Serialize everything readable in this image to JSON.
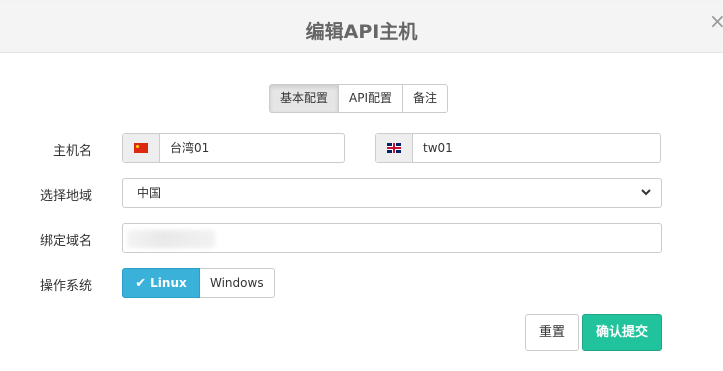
{
  "dialog": {
    "title": "编辑API主机",
    "close_glyph": "×"
  },
  "tabs": [
    {
      "label": "基本配置",
      "active": true
    },
    {
      "label": "API配置",
      "active": false
    },
    {
      "label": "备注",
      "active": false
    }
  ],
  "form": {
    "hostname_label": "主机名",
    "hostname_cn": {
      "flag_icon": "china-flag-icon",
      "value": "台湾01"
    },
    "hostname_en": {
      "flag_icon": "uk-flag-icon",
      "value": "tw01"
    },
    "region_label": "选择地域",
    "region_selected": "中国",
    "domain_label": "绑定域名",
    "os_label": "操作系统",
    "os_options": [
      {
        "label": "Linux",
        "selected": true,
        "icon": "check-icon"
      },
      {
        "label": "Windows",
        "selected": false
      }
    ]
  },
  "actions": {
    "reset_label": "重置",
    "submit_label": "确认提交"
  },
  "colors": {
    "accent_linux": "#3ab1d8",
    "submit": "#20c39c",
    "header_bg": "#f4f4f4"
  }
}
